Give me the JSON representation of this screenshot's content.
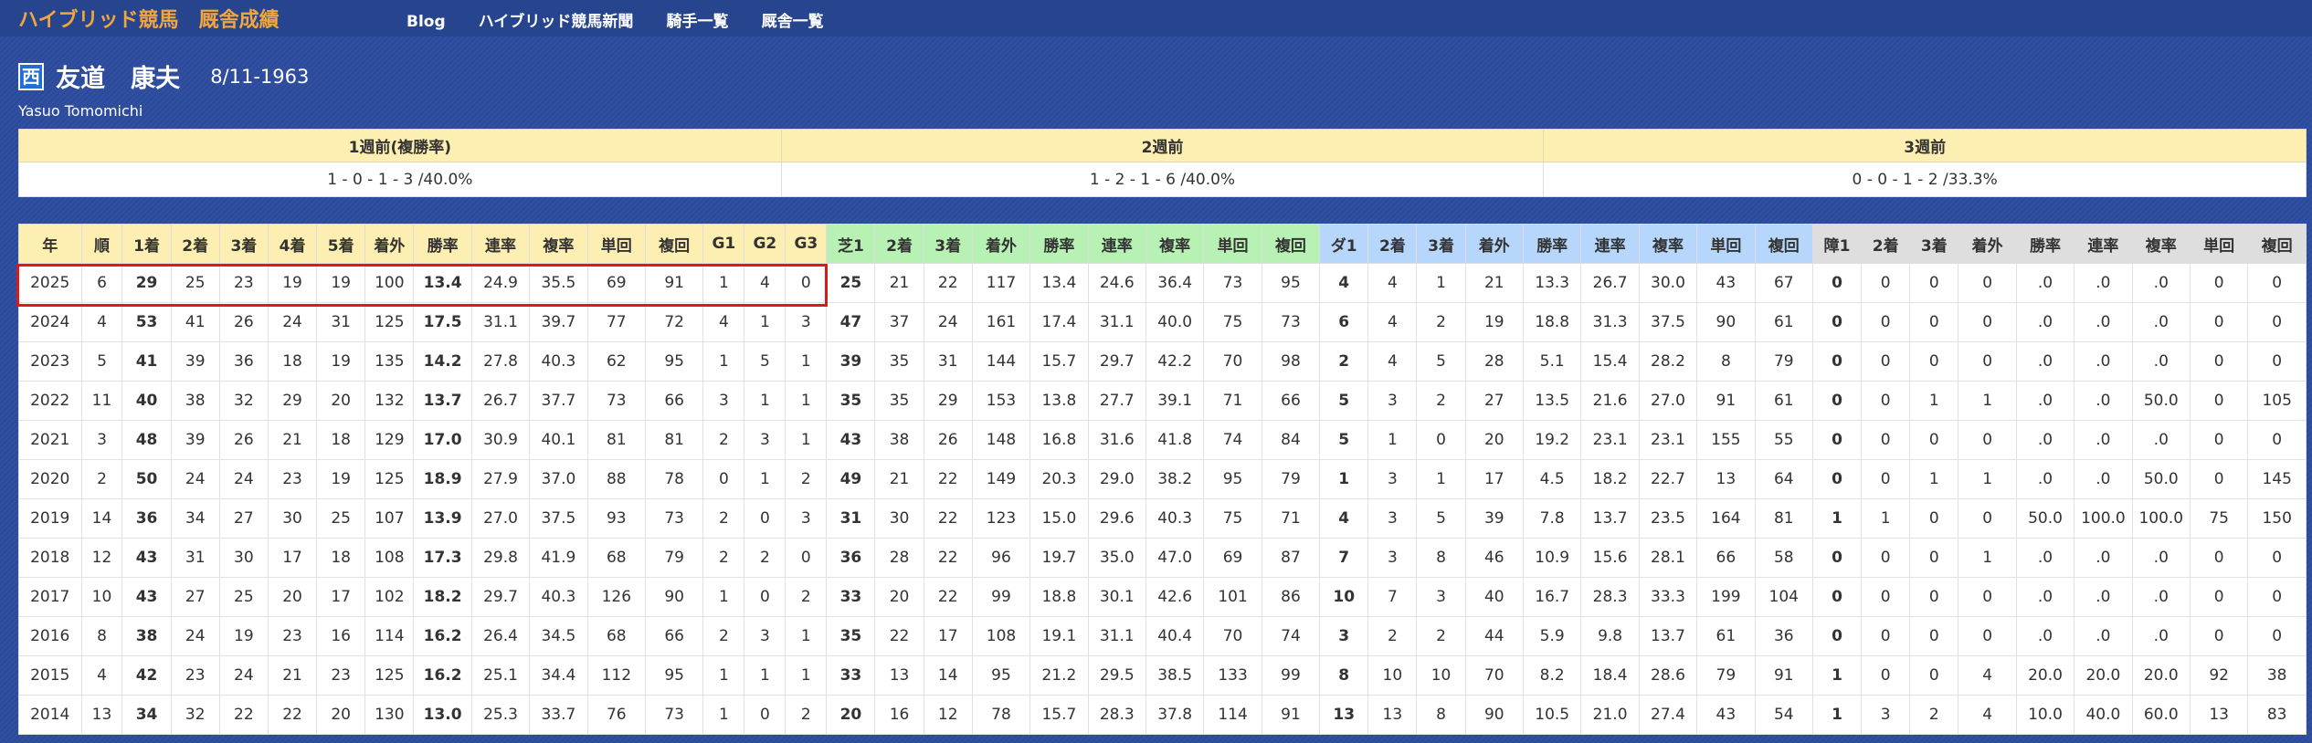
{
  "nav": {
    "brand": "ハイブリッド競馬",
    "brand_sub": "厩舎成績",
    "links": [
      "Blog",
      "ハイブリッド競馬新聞",
      "騎手一覧",
      "厩舎一覧"
    ]
  },
  "jockey": {
    "region": "西",
    "family_name": "友道",
    "given_name": "康夫",
    "dob": "8/11-1963",
    "romaji": "Yasuo Tomomichi"
  },
  "weekly": {
    "headers": [
      "1週前(複勝率)",
      "2週前",
      "3週前"
    ],
    "values": [
      "1 - 0 - 1 - 3 /40.0%",
      "1 - 2 - 1 - 6 /40.0%",
      "0 - 0 - 1 - 2 /33.3%"
    ]
  },
  "stats": {
    "headers": [
      "年",
      "順",
      "1着",
      "2着",
      "3着",
      "4着",
      "5着",
      "着外",
      "勝率",
      "連率",
      "複率",
      "単回",
      "複回",
      "G1",
      "G2",
      "G3",
      "芝1",
      "2着",
      "3着",
      "着外",
      "勝率",
      "連率",
      "複率",
      "単回",
      "複回",
      "ダ1",
      "2着",
      "3着",
      "着外",
      "勝率",
      "連率",
      "複率",
      "単回",
      "複回",
      "障1",
      "2着",
      "3着",
      "着外",
      "勝率",
      "連率",
      "複率",
      "単回",
      "複回"
    ],
    "rows": [
      [
        "2025",
        "6",
        "29",
        "25",
        "23",
        "19",
        "19",
        "100",
        "13.4",
        "24.9",
        "35.5",
        "69",
        "91",
        "1",
        "4",
        "0",
        "25",
        "21",
        "22",
        "117",
        "13.4",
        "24.6",
        "36.4",
        "73",
        "95",
        "4",
        "4",
        "1",
        "21",
        "13.3",
        "26.7",
        "30.0",
        "43",
        "67",
        "0",
        "0",
        "0",
        "0",
        ".0",
        ".0",
        ".0",
        "0",
        "0"
      ],
      [
        "2024",
        "4",
        "53",
        "41",
        "26",
        "24",
        "31",
        "125",
        "17.5",
        "31.1",
        "39.7",
        "77",
        "72",
        "4",
        "1",
        "3",
        "47",
        "37",
        "24",
        "161",
        "17.4",
        "31.1",
        "40.0",
        "75",
        "73",
        "6",
        "4",
        "2",
        "19",
        "18.8",
        "31.3",
        "37.5",
        "90",
        "61",
        "0",
        "0",
        "0",
        "0",
        ".0",
        ".0",
        ".0",
        "0",
        "0"
      ],
      [
        "2023",
        "5",
        "41",
        "39",
        "36",
        "18",
        "19",
        "135",
        "14.2",
        "27.8",
        "40.3",
        "62",
        "95",
        "1",
        "5",
        "1",
        "39",
        "35",
        "31",
        "144",
        "15.7",
        "29.7",
        "42.2",
        "70",
        "98",
        "2",
        "4",
        "5",
        "28",
        "5.1",
        "15.4",
        "28.2",
        "8",
        "79",
        "0",
        "0",
        "0",
        "0",
        ".0",
        ".0",
        ".0",
        "0",
        "0"
      ],
      [
        "2022",
        "11",
        "40",
        "38",
        "32",
        "29",
        "20",
        "132",
        "13.7",
        "26.7",
        "37.7",
        "73",
        "66",
        "3",
        "1",
        "1",
        "35",
        "35",
        "29",
        "153",
        "13.8",
        "27.7",
        "39.1",
        "71",
        "66",
        "5",
        "3",
        "2",
        "27",
        "13.5",
        "21.6",
        "27.0",
        "91",
        "61",
        "0",
        "0",
        "1",
        "1",
        ".0",
        ".0",
        "50.0",
        "0",
        "105"
      ],
      [
        "2021",
        "3",
        "48",
        "39",
        "26",
        "21",
        "18",
        "129",
        "17.0",
        "30.9",
        "40.1",
        "81",
        "81",
        "2",
        "3",
        "1",
        "43",
        "38",
        "26",
        "148",
        "16.8",
        "31.6",
        "41.8",
        "74",
        "84",
        "5",
        "1",
        "0",
        "20",
        "19.2",
        "23.1",
        "23.1",
        "155",
        "55",
        "0",
        "0",
        "0",
        "0",
        ".0",
        ".0",
        ".0",
        "0",
        "0"
      ],
      [
        "2020",
        "2",
        "50",
        "24",
        "24",
        "23",
        "19",
        "125",
        "18.9",
        "27.9",
        "37.0",
        "88",
        "78",
        "0",
        "1",
        "2",
        "49",
        "21",
        "22",
        "149",
        "20.3",
        "29.0",
        "38.2",
        "95",
        "79",
        "1",
        "3",
        "1",
        "17",
        "4.5",
        "18.2",
        "22.7",
        "13",
        "64",
        "0",
        "0",
        "1",
        "1",
        ".0",
        ".0",
        "50.0",
        "0",
        "145"
      ],
      [
        "2019",
        "14",
        "36",
        "34",
        "27",
        "30",
        "25",
        "107",
        "13.9",
        "27.0",
        "37.5",
        "93",
        "73",
        "2",
        "0",
        "3",
        "31",
        "30",
        "22",
        "123",
        "15.0",
        "29.6",
        "40.3",
        "75",
        "71",
        "4",
        "3",
        "5",
        "39",
        "7.8",
        "13.7",
        "23.5",
        "164",
        "81",
        "1",
        "1",
        "0",
        "0",
        "50.0",
        "100.0",
        "100.0",
        "75",
        "150"
      ],
      [
        "2018",
        "12",
        "43",
        "31",
        "30",
        "17",
        "18",
        "108",
        "17.3",
        "29.8",
        "41.9",
        "68",
        "79",
        "2",
        "2",
        "0",
        "36",
        "28",
        "22",
        "96",
        "19.7",
        "35.0",
        "47.0",
        "69",
        "87",
        "7",
        "3",
        "8",
        "46",
        "10.9",
        "15.6",
        "28.1",
        "66",
        "58",
        "0",
        "0",
        "0",
        "1",
        ".0",
        ".0",
        ".0",
        "0",
        "0"
      ],
      [
        "2017",
        "10",
        "43",
        "27",
        "25",
        "20",
        "17",
        "102",
        "18.2",
        "29.7",
        "40.3",
        "126",
        "90",
        "1",
        "0",
        "2",
        "33",
        "20",
        "22",
        "99",
        "18.8",
        "30.1",
        "42.6",
        "101",
        "86",
        "10",
        "7",
        "3",
        "40",
        "16.7",
        "28.3",
        "33.3",
        "199",
        "104",
        "0",
        "0",
        "0",
        "0",
        ".0",
        ".0",
        ".0",
        "0",
        "0"
      ],
      [
        "2016",
        "8",
        "38",
        "24",
        "19",
        "23",
        "16",
        "114",
        "16.2",
        "26.4",
        "34.5",
        "68",
        "66",
        "2",
        "3",
        "1",
        "35",
        "22",
        "17",
        "108",
        "19.1",
        "31.1",
        "40.4",
        "70",
        "74",
        "3",
        "2",
        "2",
        "44",
        "5.9",
        "9.8",
        "13.7",
        "61",
        "36",
        "0",
        "0",
        "0",
        "0",
        ".0",
        ".0",
        ".0",
        "0",
        "0"
      ],
      [
        "2015",
        "4",
        "42",
        "23",
        "24",
        "21",
        "23",
        "125",
        "16.2",
        "25.1",
        "34.4",
        "112",
        "95",
        "1",
        "1",
        "1",
        "33",
        "13",
        "14",
        "95",
        "21.2",
        "29.5",
        "38.5",
        "133",
        "99",
        "8",
        "10",
        "10",
        "70",
        "8.2",
        "18.4",
        "28.6",
        "79",
        "91",
        "1",
        "0",
        "0",
        "4",
        "20.0",
        "20.0",
        "20.0",
        "92",
        "38"
      ],
      [
        "2014",
        "13",
        "34",
        "32",
        "22",
        "22",
        "20",
        "130",
        "13.0",
        "25.3",
        "33.7",
        "76",
        "73",
        "1",
        "0",
        "2",
        "20",
        "16",
        "12",
        "78",
        "15.7",
        "28.3",
        "37.8",
        "114",
        "91",
        "13",
        "13",
        "8",
        "90",
        "10.5",
        "21.0",
        "27.4",
        "43",
        "54",
        "1",
        "3",
        "2",
        "4",
        "10.0",
        "40.0",
        "60.0",
        "13",
        "83"
      ]
    ]
  }
}
